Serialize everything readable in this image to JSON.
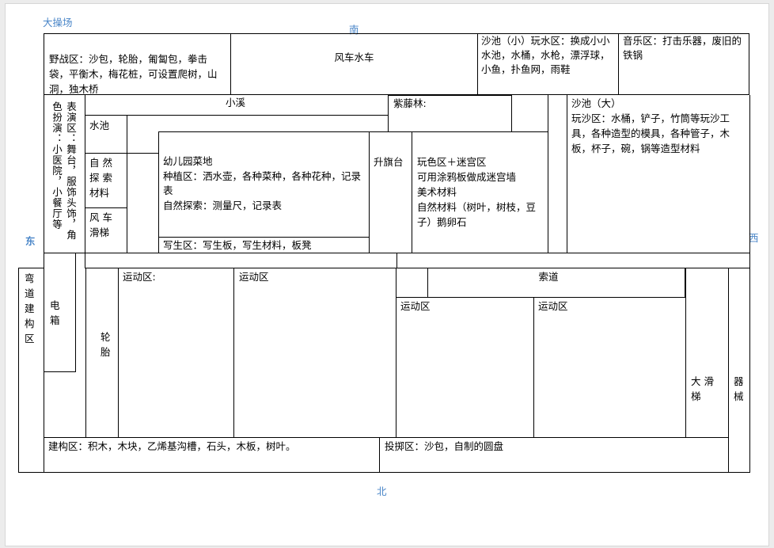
{
  "colors": {
    "compass": "#4a86c8",
    "line": "#000000"
  },
  "labels": {
    "big_playground": "大操场",
    "south": "南",
    "east": "东",
    "west": "西",
    "north": "北"
  },
  "zones": {
    "field_area": "野战区：沙包，轮胎，匍匐包，拳击袋，平衡木，梅花桩，可设置爬树，山洞，独木桥",
    "windmill_car": "风车水车",
    "sand_small": "沙池（小）玩水区：换成小小水池，水桶，水枪，漂浮球，小鱼，扑鱼网，雨鞋",
    "music_area": "音乐区：打击乐器，废旧的铁锅",
    "stream": "小溪",
    "wisteria": "紫藤林:",
    "sand_big": "沙池（大）\n玩沙区：水桶，铲子，竹筒等玩沙工具，各种造型的模具，各种管子，木板，杯子，碗，锅等造型材料",
    "performance": "表演区：舞台，服饰头饰，角色扮演：小医院，小餐厅等",
    "pond": "水池",
    "nature_explore": "自  然\n探  索\n材料",
    "wind_slide": "风  车\n滑梯",
    "vegetable_garden": "幼儿园菜地\n种植区：洒水壶，各种菜种，各种花种，记录表\n自然探索：测量尺，记录表",
    "sketch_area": "写生区：写生板，写生材料，板凳",
    "flag_platform": "升旗台",
    "color_maze": "玩色区＋迷宫区\n可用涂鸦板做成迷宫墙\n美术材料\n自然材料（树叶，树枝，豆子）鹅卵石",
    "curve_build": "弯道建构区",
    "electric_box": "电箱",
    "tires": "轮胎",
    "sport_1": "运动区:",
    "sport_2": "运动区",
    "cableway": "索道",
    "sport_3": "运动区",
    "sport_4": "运动区",
    "big_slide": "大  滑\n梯",
    "equipment": "器械",
    "construction": "建构区：积木，木块，乙烯基沟槽，石头，木板，树叶。",
    "throwing": "投掷区：沙包，自制的圆盘"
  }
}
